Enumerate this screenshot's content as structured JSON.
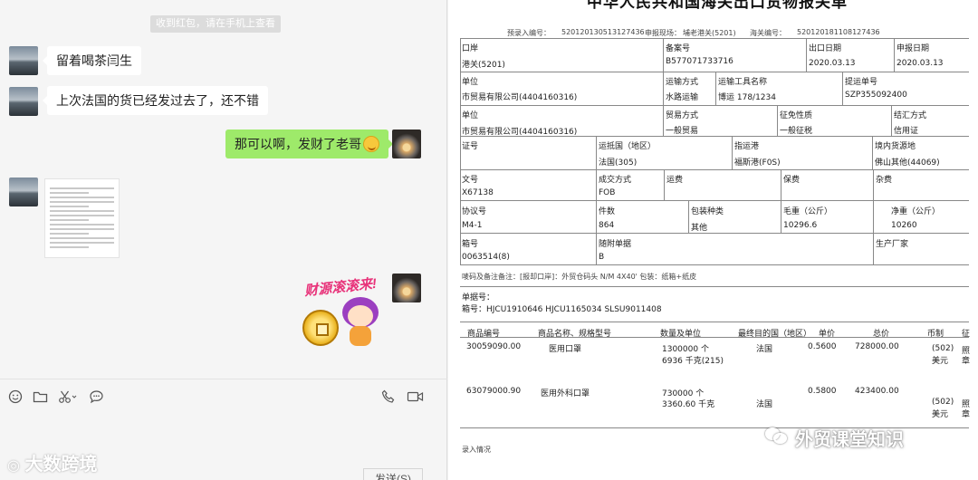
{
  "chat": {
    "system_notice": "收到红包，请在手机上查看",
    "messages": [
      {
        "text": "留着喝茶闫生"
      },
      {
        "text": "上次法国的货已经发过去了，还不错"
      },
      {
        "text": "那可以啊，发财了老哥"
      }
    ],
    "sticker_text": "财源滚滚来!",
    "send_button": "发送(S)",
    "watermark": "大数跨境",
    "icons": [
      "emoji-icon",
      "folder-icon",
      "scissors-icon",
      "chat-bubble-icon",
      "phone-icon",
      "video-icon"
    ]
  },
  "document": {
    "title": "中华人民共和国海关出口货物报关单",
    "header_row": "预录入编号：",
    "pre_entry_no": "520120130513127436",
    "customs_code_label": "申报现场：",
    "customs_code": "埔老港关(5201)",
    "customs_no_label": "海关编号：",
    "customs_no": "520120181108127436",
    "fields": {
      "port_label": "口岸",
      "port_value": "港关(5201)",
      "record_label": "备案号",
      "record_value": "B577071733716",
      "export_date_label": "出口日期",
      "export_date_value": "2020.03.13",
      "declare_date_label": "申报日期",
      "declare_date_value": "2020.03.13",
      "unit_label": "单位",
      "unit_value": "市贸易有限公司(4404160316)",
      "transport_label": "运输方式",
      "transport_value": "水路运输",
      "vehicle_label": "运输工具名称",
      "vehicle_value": "博运 178/1234",
      "bill_label": "提运单号",
      "bill_value": "SZP355092400",
      "unit2_label": "单位",
      "unit2_value": "市贸易有限公司(4404160316)",
      "trade_label": "贸易方式",
      "trade_value": "一般贸易",
      "tax_label": "征免性质",
      "tax_value": "一般征税",
      "settle_label": "结汇方式",
      "settle_value": "信用证",
      "license_label": "证号",
      "country_label": "运抵国（地区）",
      "country_value": "法国(305)",
      "dest_port_label": "指运港",
      "dest_port_value": "福斯港(F0S)",
      "origin_label": "境内货源地",
      "origin_value": "佛山其他(44069)",
      "doc_label": "文号",
      "doc_value": "X67138",
      "deal_label": "成交方式",
      "deal_value": "FOB",
      "freight_label": "运费",
      "insurance_label": "保费",
      "misc_label": "杂费",
      "contract_label": "协议号",
      "contract_value": "M4-1",
      "pieces_label": "件数",
      "pieces_value": "864",
      "pack_label": "包装种类",
      "pack_value": "其他",
      "gross_label": "毛重（公斤）",
      "gross_value": "10296.6",
      "net_label": "净重（公斤）",
      "net_value": "10260",
      "box_label": "箱号",
      "box_value": "0063514(8)",
      "attach_label": "随附单据",
      "attach_value": "B",
      "maker_label": "生产厂家",
      "marks": "唛码及备注备注：[报却口岸]：外贸仓码头 N/M 4X40' 包装：纸箱+纸皮",
      "bill_no_label": "单据号：",
      "container_line": "箱号：HJCU1910646   HJCU1165034   SLSU9011408"
    },
    "table_headers": [
      "商品编号",
      "商品名称、规格型号",
      "数量及单位",
      "最终目的国（地区）",
      "单价",
      "总价",
      "币制",
      "征"
    ],
    "items": [
      {
        "code": "30059090.00",
        "name": "医用口罩",
        "qty1": "1300000 个",
        "qty2": "6936 千克(215)",
        "country": "法国",
        "price": "0.5600",
        "total": "728000.00",
        "currency1": "(502)",
        "currency2": "美元",
        "tax1": "照",
        "tax2": "章"
      },
      {
        "code": "63079000.90",
        "name": "医用外科口罩",
        "qty1": "730000 个",
        "qty2": "3360.60 千克",
        "country": "法国",
        "price": "0.5800",
        "total": "423400.00",
        "currency1": "(502)",
        "currency2": "美元",
        "tax1": "照",
        "tax2": "章"
      }
    ],
    "footer": "录入情况",
    "watermark": "外贸课堂知识"
  }
}
